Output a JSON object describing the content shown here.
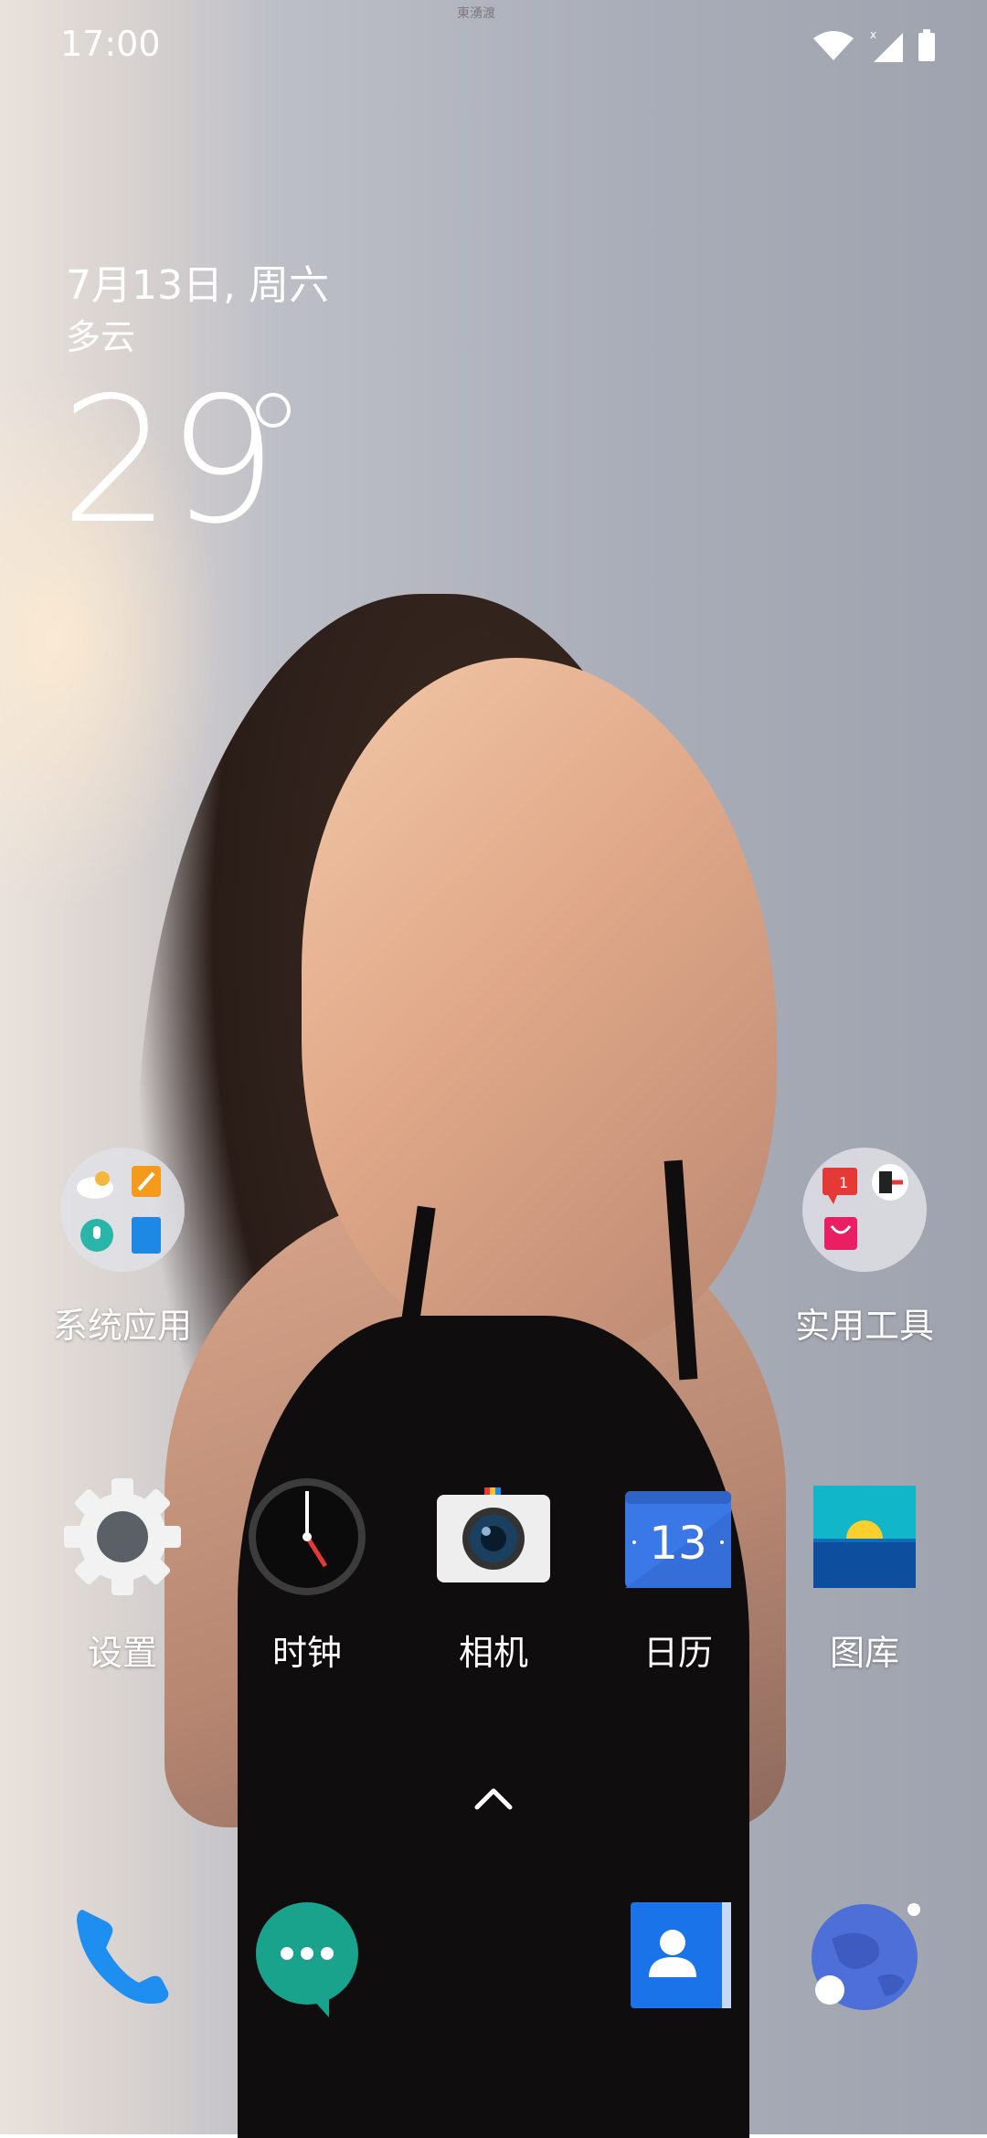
{
  "status_bar": {
    "time": "17:00",
    "watermark": "東湧渡"
  },
  "weather": {
    "date": "7月13日, 周六",
    "condition": "多云",
    "temperature": "29"
  },
  "folders": [
    {
      "label": "系统应用"
    },
    {
      "label": "实用工具"
    }
  ],
  "apps": [
    {
      "label": "设置"
    },
    {
      "label": "时钟"
    },
    {
      "label": "相机"
    },
    {
      "label": "日历",
      "calendar_day": "13"
    },
    {
      "label": "图库"
    }
  ],
  "folder_badge": "1",
  "dock": [
    {
      "name": "phone"
    },
    {
      "name": "messages"
    },
    {
      "name": "contacts"
    },
    {
      "name": "browser"
    }
  ],
  "colors": {
    "phone": "#1f8ef1",
    "messages": "#1aa38c",
    "contacts": "#1a73e8",
    "calendar": "#3b78e7",
    "gallery_top": "#12b6c9",
    "gallery_bottom": "#0d4f9e"
  }
}
